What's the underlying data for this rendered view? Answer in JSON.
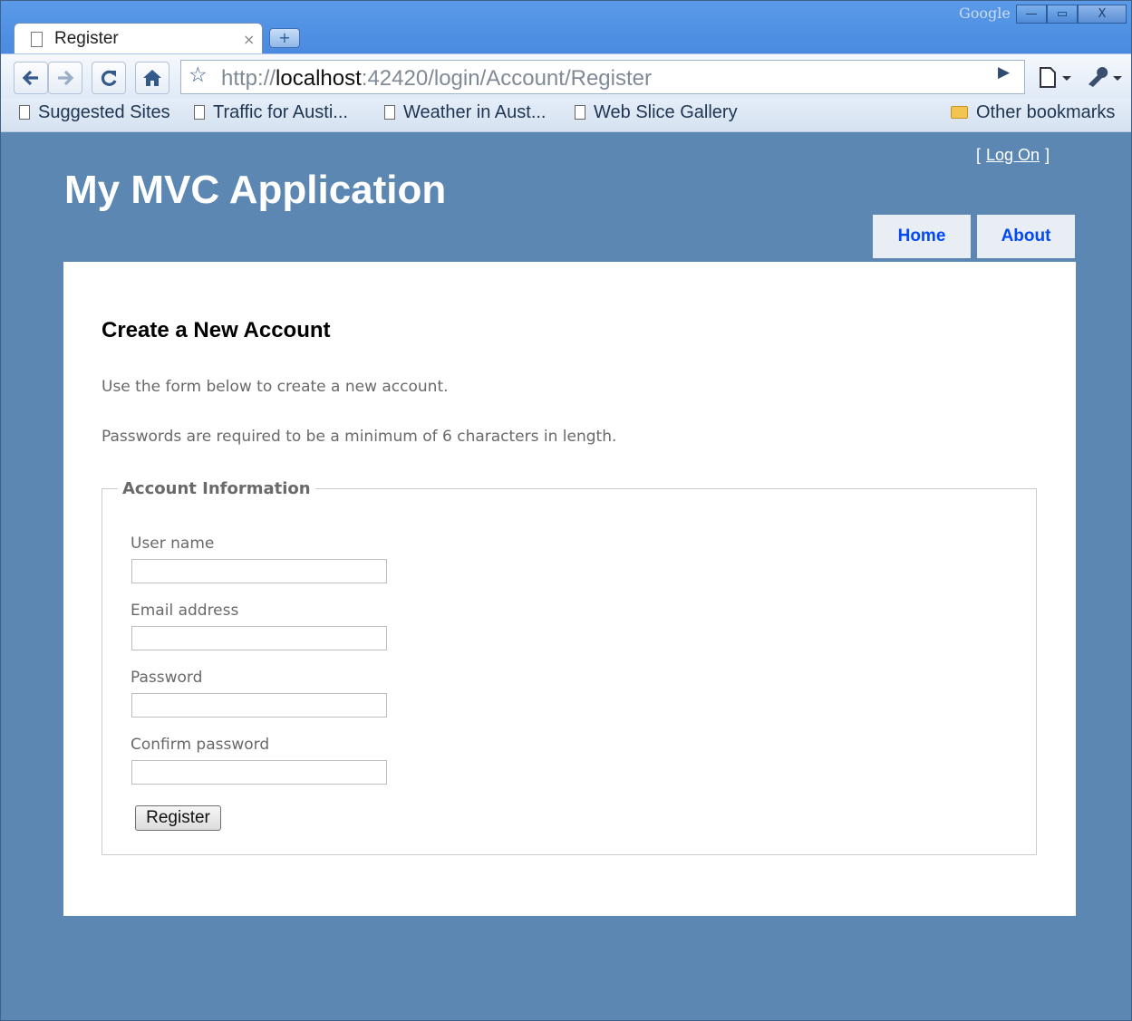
{
  "browser": {
    "brand": "Google",
    "tab_title": "Register",
    "tab_close": "×",
    "new_tab": "+",
    "window_controls": {
      "minimize": "—",
      "restore": "▭",
      "close": "X"
    },
    "url_scheme": "http://",
    "url_host": "localhost",
    "url_rest": ":42420/login/Account/Register",
    "bookmarks": [
      "Suggested Sites",
      "Traffic for Austi...",
      "Weather in Aust...",
      "Web Slice Gallery"
    ],
    "other_bookmarks": "Other bookmarks",
    "icons": [
      "page-icon",
      "back-icon",
      "forward-icon",
      "reload-icon",
      "home-icon",
      "star-icon",
      "go-icon",
      "page-menu-icon",
      "wrench-icon",
      "folder-icon"
    ]
  },
  "site": {
    "login_bracket_open": "[",
    "login_link": "Log On",
    "login_bracket_close": "]",
    "title": "My MVC Application",
    "nav": [
      "Home",
      "About"
    ]
  },
  "content": {
    "heading": "Create a New Account",
    "intro": "Use the form below to create a new account.",
    "password_rule": "Passwords are required to be a minimum of 6 characters in length.",
    "fieldset_legend": "Account Information",
    "fields": {
      "username_label": "User name",
      "email_label": "Email address",
      "password_label": "Password",
      "confirm_label": "Confirm password",
      "username_value": "",
      "email_value": "",
      "password_value": "",
      "confirm_value": ""
    },
    "submit": "Register"
  },
  "colors": {
    "page_background": "#5c87b2",
    "nav_link": "#034af3",
    "text_gray": "#696969"
  }
}
